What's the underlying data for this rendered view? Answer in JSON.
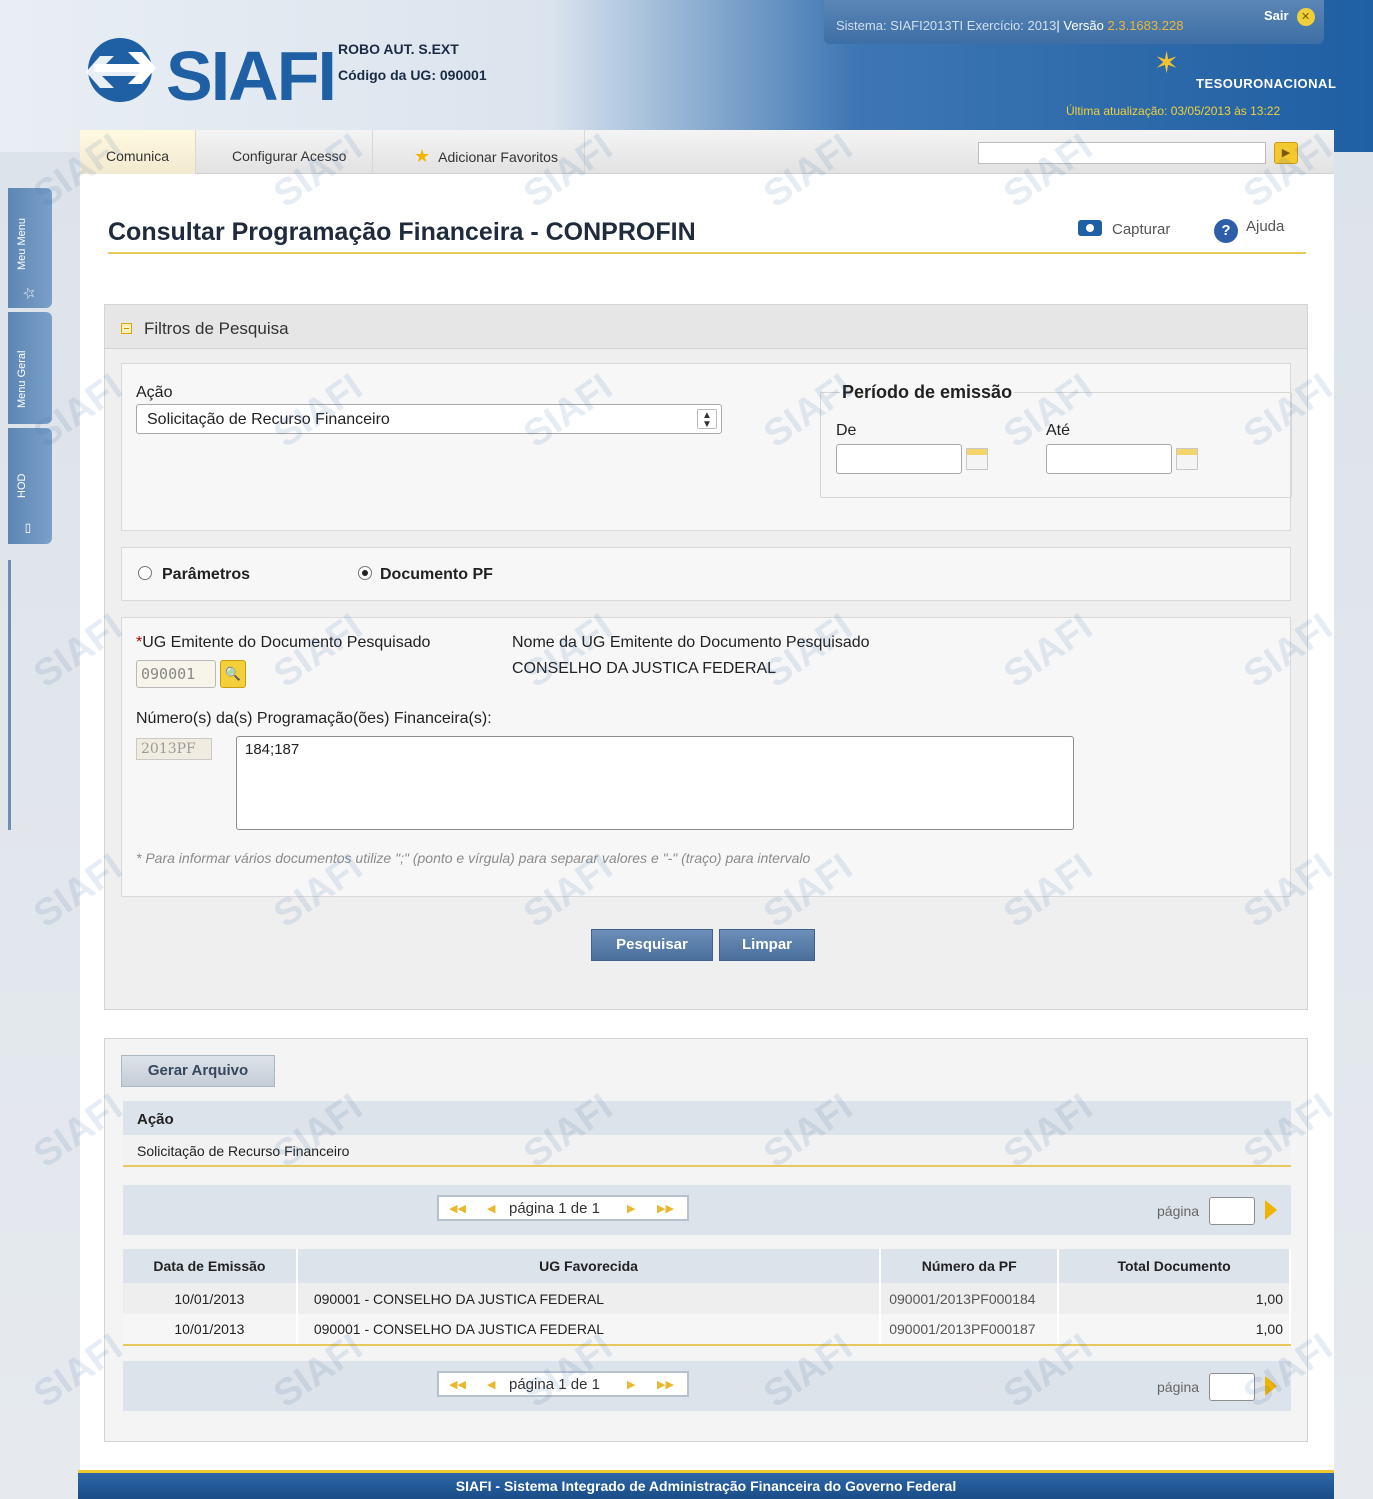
{
  "header": {
    "logo_text": "SIAFI",
    "user_name": "ROBO AUT. S.EXT",
    "ug_label": "Código da UG:",
    "ug_value": "090001",
    "sys_label": "Sistema: SIAFI2013TI Exercício: 2013",
    "sys_separator": "|",
    "version_label": "Versão",
    "version_value": "2.3.1683.228",
    "sair": "Sair",
    "tesouro": "TESOURONACIONAL",
    "ultima": "Última atualização: 03/05/2013 às 13:22"
  },
  "side_tabs": [
    "Meu Menu",
    "Menu Geral",
    "HOD"
  ],
  "menu": {
    "items": [
      "Comunica",
      "Configurar Acesso",
      "Adicionar Favoritos"
    ],
    "search_placeholder": ""
  },
  "page": {
    "title": "Consultar Programação Financeira - CONPROFIN",
    "capturar": "Capturar",
    "ajuda": "Ajuda"
  },
  "filters": {
    "title": "Filtros de Pesquisa",
    "acao_label": "Ação",
    "acao_value": "Solicitação de Recurso Financeiro",
    "periodo_label": "Período de emissão",
    "de_label": "De",
    "ate_label": "Até",
    "de_value": "",
    "ate_value": "",
    "radio_parametros": "Parâmetros",
    "radio_documento": "Documento PF",
    "selected_radio": "Documento PF",
    "ug_label": "UG Emitente do Documento Pesquisado",
    "ug_required_mark": "*",
    "ug_value": "090001",
    "nome_label": "Nome da UG Emitente do Documento Pesquisado",
    "nome_value": "CONSELHO DA JUSTICA FEDERAL",
    "numero_label": "Número(s) da(s) Programação(ões) Financeira(s):",
    "numero_prefix": "2013PF",
    "numero_value": "184;187",
    "hint": "* Para informar vários documentos utilize \";\" (ponto e vírgula) para separar valores e \"-\" (traço) para intervalo",
    "pesquisar": "Pesquisar",
    "limpar": "Limpar"
  },
  "results": {
    "gerar_arquivo": "Gerar Arquivo",
    "acao_header": "Ação",
    "acao_value": "Solicitação de Recurso Financeiro",
    "pager_text": "página 1 de 1",
    "pager_label": "página",
    "columns": [
      "Data de Emissão",
      "UG Favorecida",
      "Número da PF",
      "Total Documento"
    ],
    "rows": [
      {
        "data": "10/01/2013",
        "ug": "090001 - CONSELHO DA JUSTICA FEDERAL",
        "numero": "090001/2013PF000184",
        "total": "1,00"
      },
      {
        "data": "10/01/2013",
        "ug": "090001 - CONSELHO DA JUSTICA FEDERAL",
        "numero": "090001/2013PF000187",
        "total": "1,00"
      }
    ]
  },
  "footer": "SIAFI - Sistema Integrado de Administração Financeira do Governo Federal",
  "watermark_text": "SIAFI",
  "colors": {
    "brand_blue": "#1f5fa3",
    "accent_yellow": "#f0c62d",
    "button_blue": "#4a6f9c"
  }
}
